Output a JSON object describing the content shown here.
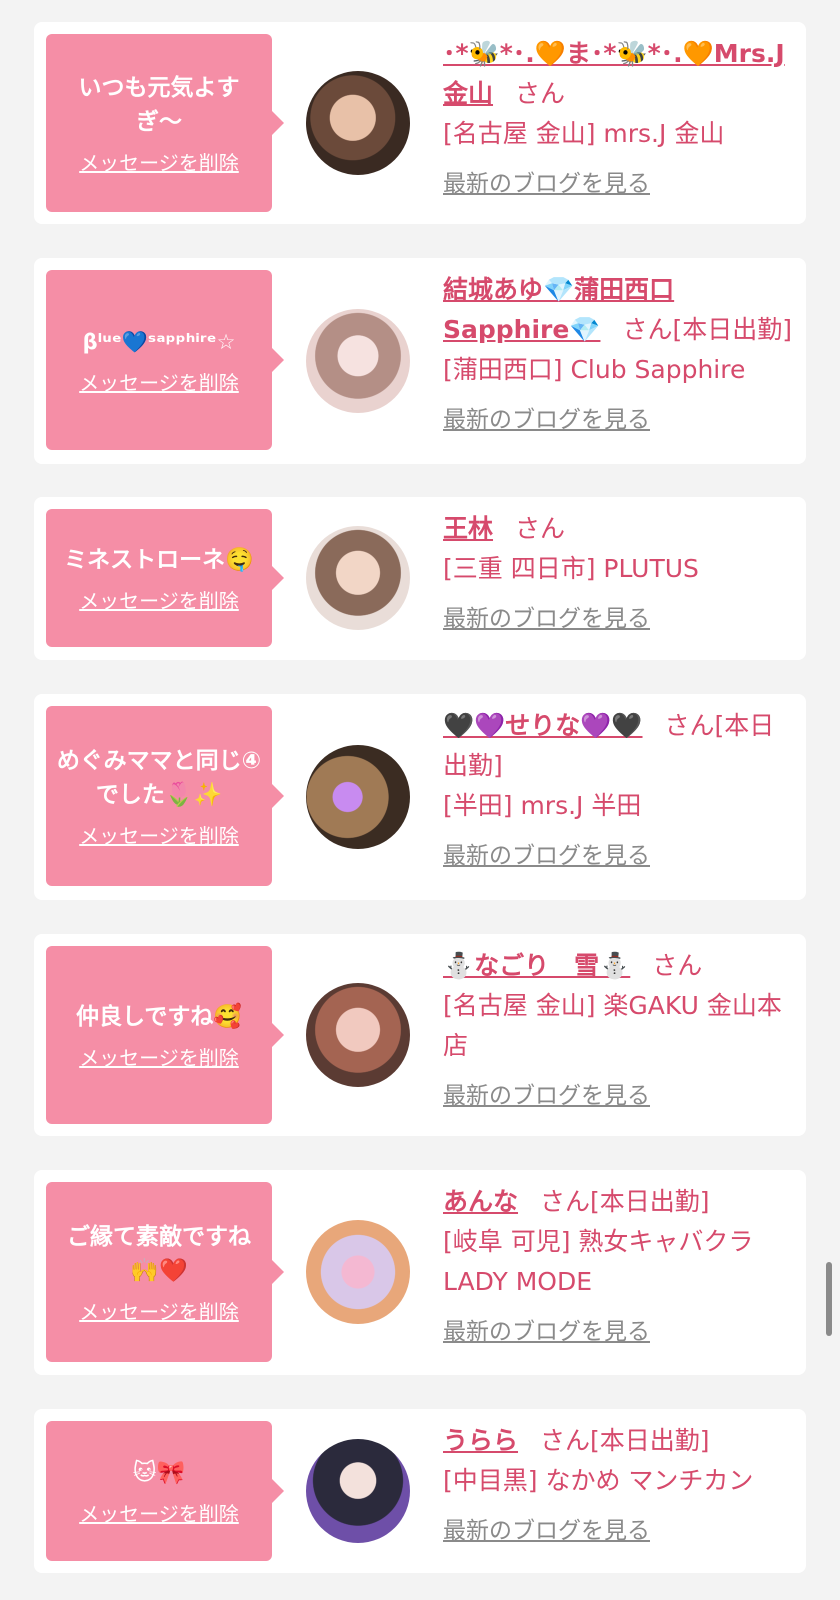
{
  "entries": [
    {
      "message": "いつも元気よすぎ〜",
      "delete_label": "メッセージを削除",
      "name": "･*🐝*･.🧡ま･*🐝*･.🧡Mrs.J金山",
      "honorific": "さん",
      "status": "",
      "shop": "[名古屋 金山] mrs.J 金山",
      "blog_label": "最新のブログを見る"
    },
    {
      "message": "βˡᵘᵉ💙ˢᵃᵖᵖʰⁱʳᵉ☆",
      "delete_label": "メッセージを削除",
      "name": "結城あゆ💎蒲田西口Sapphire💎",
      "honorific": "さん",
      "status": "[本日出勤]",
      "shop": "[蒲田西口] Club Sapphire",
      "blog_label": "最新のブログを見る"
    },
    {
      "message": "ミネストローネ🤤",
      "delete_label": "メッセージを削除",
      "name": "王林",
      "honorific": "さん",
      "status": "",
      "shop": "[三重 四日市] PLUTUS",
      "blog_label": "最新のブログを見る"
    },
    {
      "message": "めぐみママと同じ④でした🌷✨",
      "delete_label": "メッセージを削除",
      "name": "🖤💜せりな💜🖤",
      "honorific": "さん",
      "status": "[本日出勤]",
      "shop": "[半田] mrs.J 半田",
      "blog_label": "最新のブログを見る"
    },
    {
      "message": "仲良しですね🥰",
      "delete_label": "メッセージを削除",
      "name": "⛄なごり　雪⛄",
      "honorific": "さん",
      "status": "",
      "shop": "[名古屋 金山] 楽GAKU 金山本店",
      "blog_label": "最新のブログを見る"
    },
    {
      "message": "ご縁て素敵ですね🙌❤️",
      "delete_label": "メッセージを削除",
      "name": "あんな",
      "honorific": "さん",
      "status": "[本日出勤]",
      "shop": "[岐阜 可児] 熟女キャバクラ LADY MODE",
      "blog_label": "最新のブログを見る"
    },
    {
      "message": "🐱🎀",
      "delete_label": "メッセージを削除",
      "name": "うらら",
      "honorific": "さん",
      "status": "[本日出勤]",
      "shop": "[中目黒] なかめ マンチカン",
      "blog_label": "最新のブログを見る"
    }
  ],
  "colors": {
    "bubble": "#f58ea6",
    "accent": "#d64a6c",
    "blog_link": "#8a8a8a",
    "page_bg": "#f3f3f3"
  }
}
